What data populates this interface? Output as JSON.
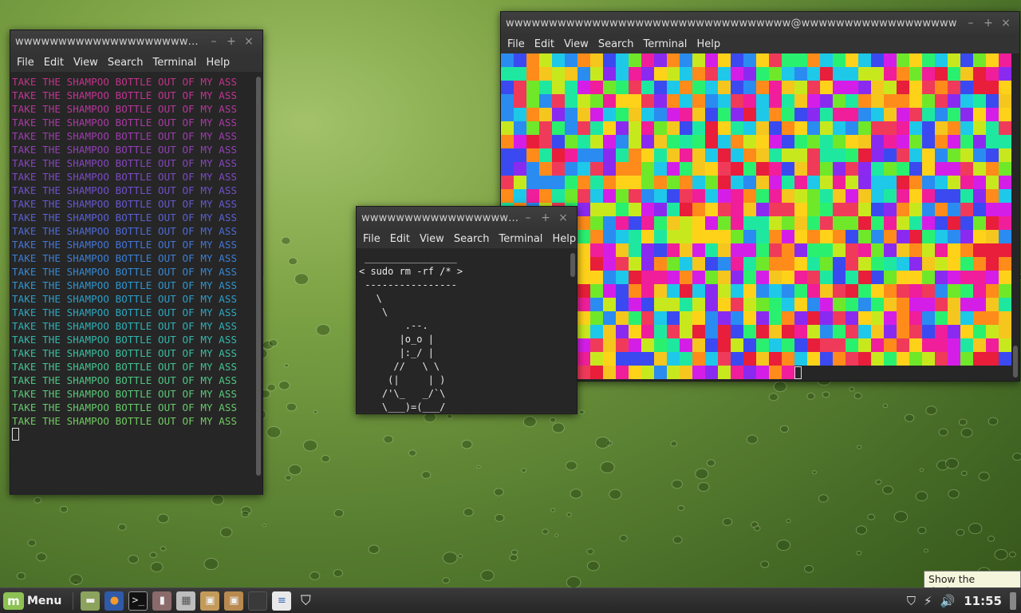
{
  "windows": {
    "left_terminal": {
      "title": "wwwwwwwwwwwwwwwwwwwww...",
      "menu": [
        "File",
        "Edit",
        "View",
        "Search",
        "Terminal",
        "Help"
      ],
      "line_text": "TAKE THE SHAMPOO BOTTLE OUT OF MY ASS",
      "line_colors": [
        "#c2338a",
        "#c23494",
        "#b6379b",
        "#a93aa5",
        "#9d3cae",
        "#9140b5",
        "#8445bc",
        "#7a4ac4",
        "#6f50ca",
        "#6458cf",
        "#5a60d2",
        "#4d6ad5",
        "#4474d6",
        "#3b7ed6",
        "#3588d3",
        "#2f94cf",
        "#2c9ec8",
        "#2ba7c0",
        "#2eafb6",
        "#33b7aa",
        "#3abe9e",
        "#44c291",
        "#4fc584",
        "#5ac778",
        "#66c96c",
        "#71ca62"
      ]
    },
    "cowsay_terminal": {
      "title": "wwwwwwwwwwwwwwwwww...",
      "menu": [
        "File",
        "Edit",
        "View",
        "Search",
        "Terminal",
        "Help"
      ],
      "art": " ________________\n< sudo rm -rf /* >\n ----------------\n   \\\n    \\\n        .--.\n       |o_o |\n       |:_/ |\n      //   \\ \\\n     (|     | )\n    /'\\_   _/`\\\n    \\___)=(___/"
    },
    "color_terminal": {
      "title": "wwwwwwwwwwwwwwwwwwwwwwwwwwwwwwwww@wwwwwwwwwwwwwwwwww",
      "menu": [
        "File",
        "Edit",
        "View",
        "Search",
        "Terminal",
        "Help"
      ],
      "palette": [
        "#f03a5a",
        "#ff8c1a",
        "#ffd21a",
        "#c8e81e",
        "#6fe82a",
        "#1ee8a0",
        "#1ec8e8",
        "#2a8cf0",
        "#3a4af0",
        "#8a2af0",
        "#d41ee8",
        "#f01e9a",
        "#e81e3a",
        "#f5c61e",
        "#2af06f"
      ]
    }
  },
  "panel": {
    "menu_label": "Menu",
    "clock": "11:55",
    "tooltip": "Show the desktop"
  }
}
